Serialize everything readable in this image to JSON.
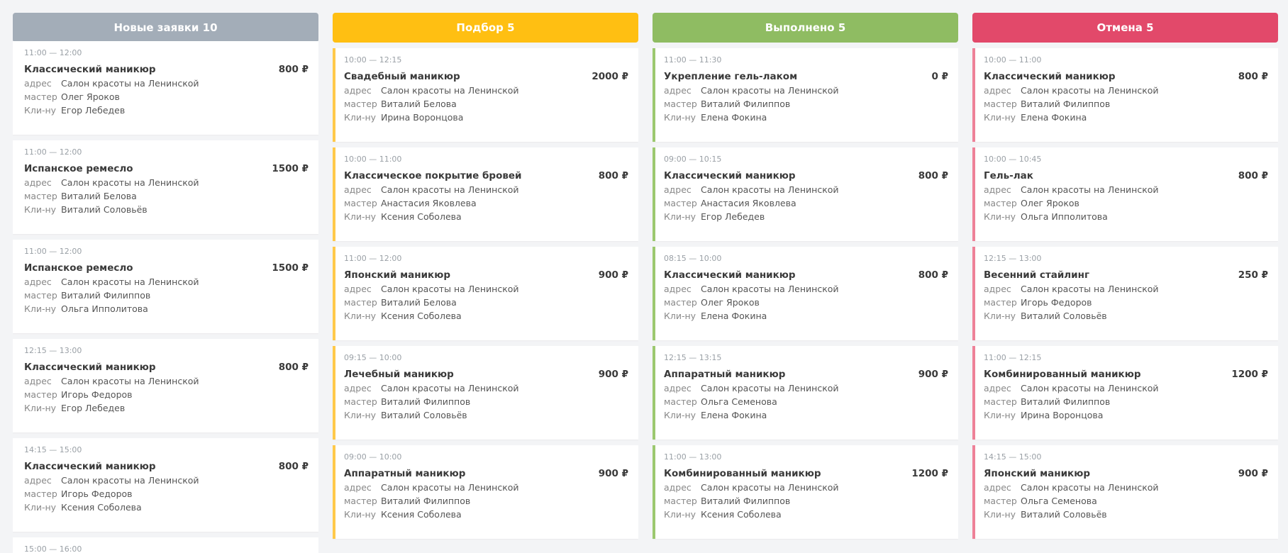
{
  "labels": {
    "address": "адрес",
    "master": "мастер",
    "client": "Кли-ну"
  },
  "columns": [
    {
      "title": "Новые заявки 10",
      "color": "#a3adb8",
      "card_color": "",
      "shift": true,
      "cards": [
        {
          "time": "11:00 — 12:00",
          "title": "Классический маникюр",
          "price": "800 ₽",
          "address": "Салон красоты на Ленинской",
          "master": "Олег Яроков",
          "client": "Егор Лебедев"
        },
        {
          "time": "11:00 — 12:00",
          "title": "Испанское ремесло",
          "price": "1500 ₽",
          "address": "Салон красоты на Ленинской",
          "master": "Виталий Белова",
          "client": "Виталий Соловьёв"
        },
        {
          "time": "11:00 — 12:00",
          "title": "Испанское ремесло",
          "price": "1500 ₽",
          "address": "Салон красоты на Ленинской",
          "master": "Виталий Филиппов",
          "client": "Ольга Ипполитова"
        },
        {
          "time": "12:15 — 13:00",
          "title": "Классический маникюр",
          "price": "800 ₽",
          "address": "Салон красоты на Ленинской",
          "master": "Игорь Федоров",
          "client": "Егор Лебедев"
        },
        {
          "time": "14:15 — 15:00",
          "title": "Классический маникюр",
          "price": "800 ₽",
          "address": "Салон красоты на Ленинской",
          "master": "Игорь Федоров",
          "client": "Ксения Соболева"
        },
        {
          "time": "15:00 — 16:00",
          "title": "",
          "price": "",
          "address": "",
          "master": "",
          "client": ""
        }
      ]
    },
    {
      "title": "Подбор 5",
      "color": "#ffbf12",
      "card_color": "#ffc94a",
      "shift": false,
      "cards": [
        {
          "time": "10:00 — 12:15",
          "title": "Свадебный маникюр",
          "price": "2000 ₽",
          "address": "Салон красоты на Ленинской",
          "master": "Виталий Белова",
          "client": "Ирина Воронцова"
        },
        {
          "time": "10:00 — 11:00",
          "title": "Классическое покрытие бровей",
          "price": "800 ₽",
          "address": "Салон красоты на Ленинской",
          "master": "Анастасия Яковлева",
          "client": "Ксения Соболева"
        },
        {
          "time": "11:00 — 12:00",
          "title": "Японский маникюр",
          "price": "900 ₽",
          "address": "Салон красоты на Ленинской",
          "master": "Виталий Белова",
          "client": "Ксения Соболева"
        },
        {
          "time": "09:15 — 10:00",
          "title": "Лечебный маникюр",
          "price": "900 ₽",
          "address": "Салон красоты на Ленинской",
          "master": "Виталий Филиппов",
          "client": "Виталий Соловьёв"
        },
        {
          "time": "09:00 — 10:00",
          "title": "Аппаратный маникюр",
          "price": "900 ₽",
          "address": "Салон красоты на Ленинской",
          "master": "Виталий Филиппов",
          "client": "Ксения Соболева"
        }
      ]
    },
    {
      "title": "Выполнено 5",
      "color": "#8fbc62",
      "card_color": "#9cc86f",
      "shift": false,
      "cards": [
        {
          "time": "11:00 — 11:30",
          "title": "Укрепление гель-лаком",
          "price": "0 ₽",
          "address": "Салон красоты на Ленинской",
          "master": "Виталий Филиппов",
          "client": "Елена Фокина"
        },
        {
          "time": "09:00 — 10:15",
          "title": "Классический маникюр",
          "price": "800 ₽",
          "address": "Салон красоты на Ленинской",
          "master": "Анастасия Яковлева",
          "client": "Егор Лебедев"
        },
        {
          "time": "08:15 — 10:00",
          "title": "Классический маникюр",
          "price": "800 ₽",
          "address": "Салон красоты на Ленинской",
          "master": "Олег Яроков",
          "client": "Елена Фокина"
        },
        {
          "time": "12:15 — 13:15",
          "title": "Аппаратный маникюр",
          "price": "900 ₽",
          "address": "Салон красоты на Ленинской",
          "master": "Ольга Семенова",
          "client": "Елена Фокина"
        },
        {
          "time": "11:00 — 13:00",
          "title": "Комбинированный маникюр",
          "price": "1200 ₽",
          "address": "Салон красоты на Ленинской",
          "master": "Виталий Филиппов",
          "client": "Ксения Соболева"
        }
      ]
    },
    {
      "title": "Отмена 5",
      "color": "#e2496a",
      "card_color": "#ee8198",
      "shift": false,
      "cards": [
        {
          "time": "10:00 — 11:00",
          "title": "Классический маникюр",
          "price": "800 ₽",
          "address": "Салон красоты на Ленинской",
          "master": "Виталий Филиппов",
          "client": "Елена Фокина"
        },
        {
          "time": "10:00 — 10:45",
          "title": "Гель-лак",
          "price": "800 ₽",
          "address": "Салон красоты на Ленинской",
          "master": "Олег Яроков",
          "client": "Ольга Ипполитова"
        },
        {
          "time": "12:15 — 13:00",
          "title": "Весенний стайлинг",
          "price": "250 ₽",
          "address": "Салон красоты на Ленинской",
          "master": "Игорь Федоров",
          "client": "Виталий Соловьёв"
        },
        {
          "time": "11:00 — 12:15",
          "title": "Комбинированный маникюр",
          "price": "1200 ₽",
          "address": "Салон красоты на Ленинской",
          "master": "Виталий Филиппов",
          "client": "Ирина Воронцова"
        },
        {
          "time": "14:15 — 15:00",
          "title": "Японский маникюр",
          "price": "900 ₽",
          "address": "Салон красоты на Ленинской",
          "master": "Ольга Семенова",
          "client": "Виталий Соловьёв"
        }
      ]
    }
  ]
}
